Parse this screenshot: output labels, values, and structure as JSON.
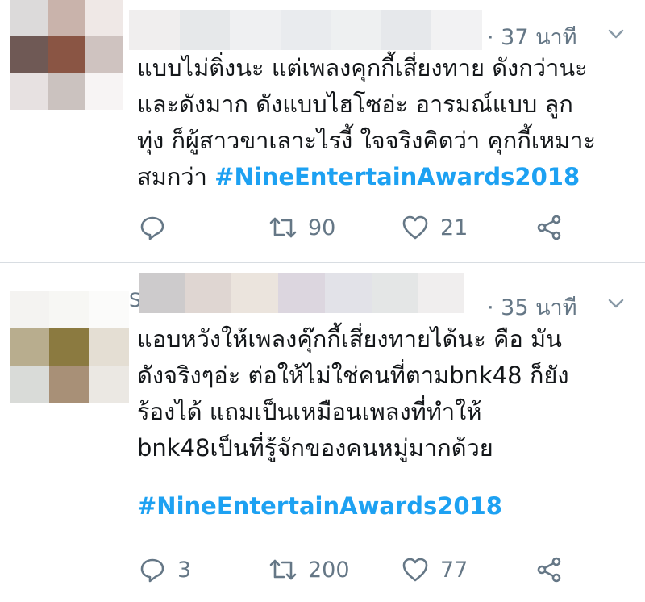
{
  "tweets": [
    {
      "time": "· 37 นาที",
      "lines": [
        "แบบไม่ติ่งนะ แต่เพลงคุกกี้เสี่ยงทาย ดังกว่านะ",
        "และดังมาก ดังแบบไฮโซอ่ะ อารมณ์แบบ ลูก",
        "ทุ่ง ก็ผู้สาวขาเลาะไรงี้ ใจจริงคิดว่า คุกกี้เหมาะ"
      ],
      "last_line_prefix": "สมกว่า ",
      "hashtag": "#NineEntertainAwards2018",
      "reply_count": "",
      "retweet_count": "90",
      "like_count": "21"
    },
    {
      "name_initial": "S",
      "time": "· 35 นาที",
      "lines": [
        "แอบหวังให้เพลงคุ๊กกี้เสี่ยงทายได้นะ คือ มัน",
        "ดังจริงๆอ่ะ ต่อให้ไม่ใช่คนที่ตามbnk48 ก็ยัง",
        "ร้องได้ แถมเป็นเหมือนเพลงที่ทำให้",
        "bnk48เป็นที่รู้จักของคนหมู่มากด้วย"
      ],
      "hashtag": "#NineEntertainAwards2018",
      "reply_count": "3",
      "retweet_count": "200",
      "like_count": "77"
    }
  ],
  "colors": {
    "text": "#14171a",
    "muted": "#657786",
    "link": "#1da1f2",
    "divider": "#d8dde2"
  },
  "icons": {
    "reply": "reply-icon",
    "retweet": "retweet-icon",
    "like": "heart-icon",
    "share": "share-icon",
    "caret": "chevron-down-icon"
  }
}
